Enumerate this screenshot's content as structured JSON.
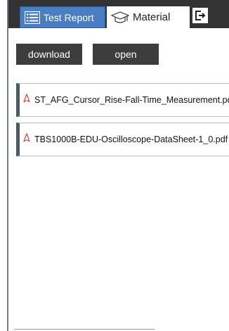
{
  "tabs": {
    "test_report": {
      "label": "Test Report",
      "icon": "list-icon"
    },
    "material": {
      "label": "Material",
      "icon": "graduation-cap-icon"
    },
    "exit": {
      "icon": "exit-icon"
    }
  },
  "toolbar": {
    "download_label": "download",
    "open_label": "open"
  },
  "files": [
    {
      "name": "ST_AFG_Cursor_Rise-Fall-Time_Measurement.pdf",
      "icon": "pdf-icon"
    },
    {
      "name": "TBS1000B-EDU-Oscilloscope-DataSheet-1_0.pdf",
      "icon": "pdf-icon"
    }
  ],
  "colors": {
    "active_tab": "#4a7ec0",
    "tab_bar": "#333333",
    "button": "#3d3d3d",
    "pdf_icon": "#d0312d"
  }
}
